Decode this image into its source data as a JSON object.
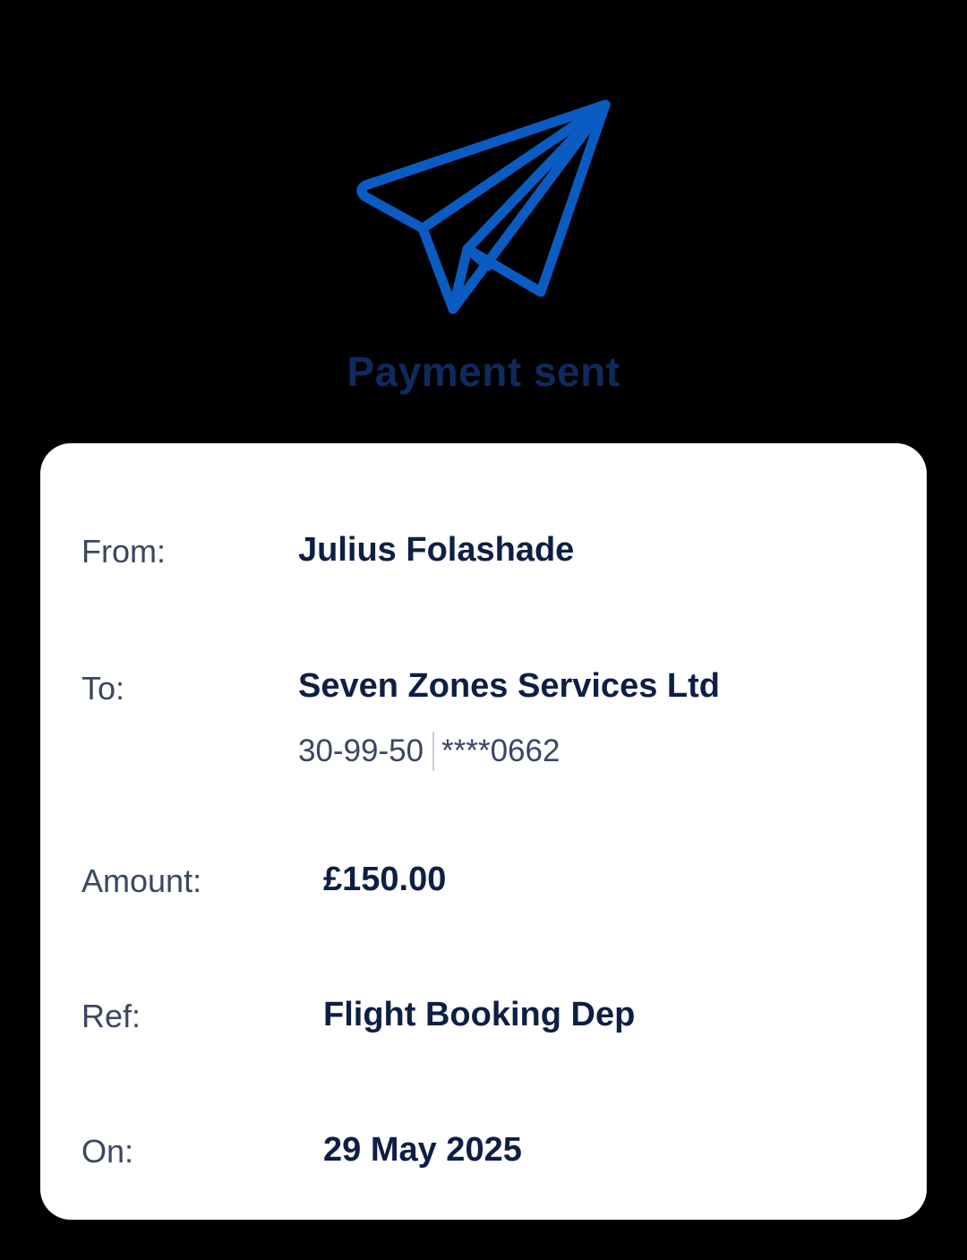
{
  "header": {
    "icon": "paper-plane-icon",
    "title": "Payment sent",
    "icon_color": "#0a5cc2",
    "title_color": "#0f2a5e"
  },
  "details": {
    "from": {
      "label": "From:",
      "value": "Julius Folashade"
    },
    "to": {
      "label": "To:",
      "value": "Seven Zones Services Ltd",
      "sort_code": "30-99-50",
      "account": "****0662"
    },
    "amount": {
      "label": "Amount:",
      "value": "£150.00"
    },
    "ref": {
      "label": "Ref:",
      "value": "Flight Booking Dep"
    },
    "on": {
      "label": "On:",
      "value": "29 May 2025"
    }
  }
}
